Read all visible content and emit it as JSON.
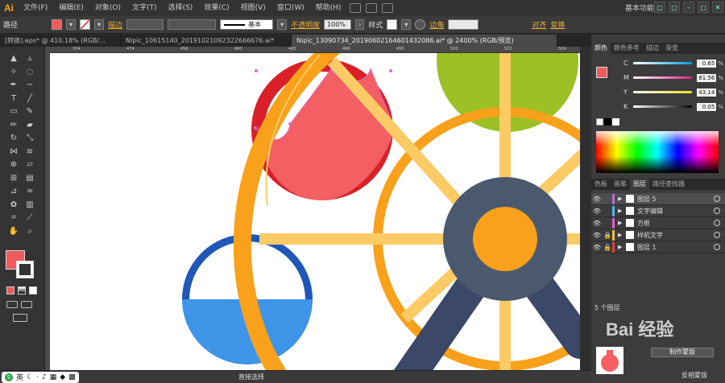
{
  "menubar": {
    "logo": "Ai",
    "items": [
      "文件(F)",
      "编辑(E)",
      "对象(O)",
      "文字(T)",
      "选择(S)",
      "效果(C)",
      "视图(V)",
      "窗口(W)",
      "帮助(H)"
    ],
    "workspace": "基本功能"
  },
  "control": {
    "selection": "路径",
    "stroke_link": "描边",
    "stroke_style": "基本",
    "opacity_link": "不透明度",
    "opacity_value": "100%",
    "style_label": "样式",
    "align_link": "对齐",
    "corner_link": "边角",
    "transform_link": "变换",
    "fill_color": "#f05a5a"
  },
  "tabs": [
    {
      "label": "[转换].eps* @ 410.18% (RGB/...",
      "active": false
    },
    {
      "label": "Nipic_10615140_20191021092322666676.ai*",
      "active": false
    },
    {
      "label": "Nipic_13090734_20190602164601432086.ai* @ 2400% (RGB/预览)",
      "active": true
    }
  ],
  "ruler": {
    "ticks": [
      "374",
      "474",
      "456",
      "490",
      "495",
      "496",
      "495",
      "500",
      "502",
      "504"
    ]
  },
  "panels": {
    "top_tabs": [
      "颜色",
      "颜色参考",
      "描边",
      "渐变"
    ],
    "color_sliders": [
      {
        "letter": "C",
        "value": "0.65",
        "unit": "%"
      },
      {
        "letter": "M",
        "value": "61.56",
        "unit": "%"
      },
      {
        "letter": "Y",
        "value": "43.14",
        "unit": "%"
      },
      {
        "letter": "K",
        "value": "0.05",
        "unit": "%"
      }
    ],
    "mid_tabs": [
      "色板",
      "画笔",
      "图层",
      "路径查找器"
    ],
    "layers": [
      {
        "name": "图层 5",
        "color": "#c06ad8",
        "selected": true,
        "locked": false
      },
      {
        "name": "文字编辑",
        "color": "#46b8e6",
        "selected": false,
        "locked": false
      },
      {
        "name": "方框",
        "color": "#e05ad0",
        "selected": false,
        "locked": false
      },
      {
        "name": "样机文字",
        "color": "#f0c040",
        "selected": false,
        "locked": true
      },
      {
        "name": "图层 1",
        "color": "#e04040",
        "selected": false,
        "locked": true
      }
    ],
    "layer_count": "5 个图层",
    "make_mask_button": "制作蒙版",
    "reverse_mask": "反相蒙版"
  },
  "status": {
    "ime_label": "英",
    "current_tool": "直接选择"
  },
  "watermark": "Bai 经验",
  "icons": [
    "select-arrow-icon",
    "direct-select-icon",
    "magic-wand-icon",
    "lasso-icon",
    "pen-icon",
    "curvature-icon",
    "type-icon",
    "line-icon",
    "rect-icon",
    "brush-icon",
    "pencil-icon",
    "eraser-icon",
    "rotate-icon",
    "scale-icon",
    "width-icon",
    "warp-icon",
    "shape-builder-icon",
    "perspective-icon",
    "mesh-icon",
    "gradient-icon",
    "eyedropper-icon",
    "blend-icon",
    "symbol-icon",
    "graph-icon",
    "artboard-icon",
    "slice-icon",
    "hand-icon",
    "zoom-icon"
  ]
}
